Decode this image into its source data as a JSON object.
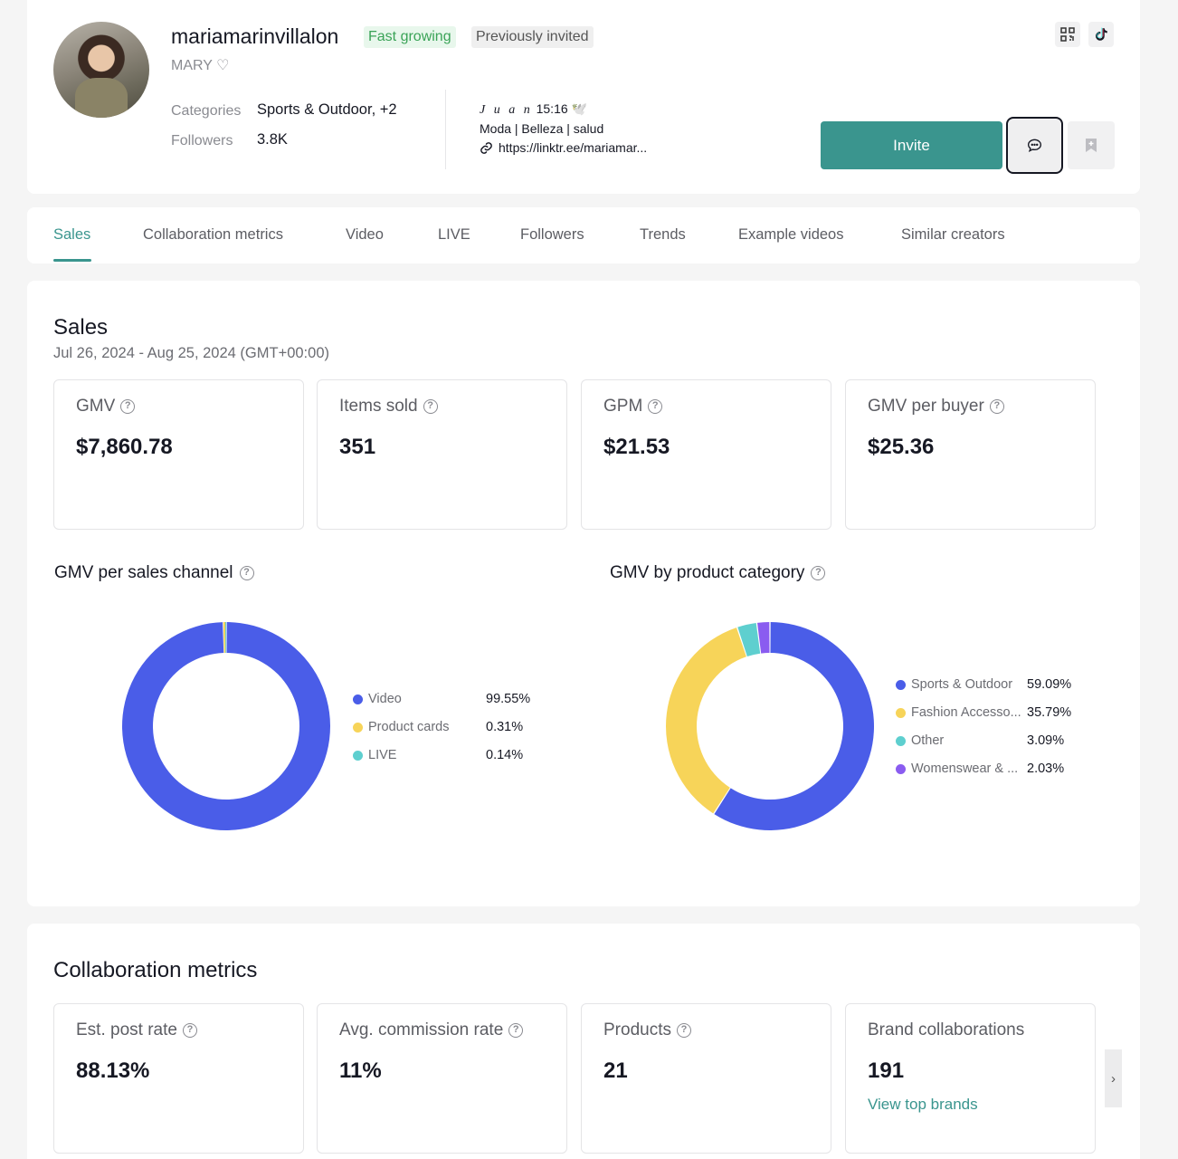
{
  "profile": {
    "username": "mariamarinvillalon",
    "badges": [
      "Fast growing",
      "Previously invited"
    ],
    "nickname": "MARY ♡",
    "categories_label": "Categories",
    "categories_value": "Sports & Outdoor, +2",
    "followers_label": "Followers",
    "followers_value": "3.8K",
    "bio_name": "J u a n",
    "bio_name_rest": "15:16 🕊️",
    "bio_line2": "Moda | Belleza  | salud",
    "bio_link": "https://linktr.ee/mariamar...",
    "invite_label": "Invite"
  },
  "tabs": [
    "Sales",
    "Collaboration metrics",
    "Video",
    "LIVE",
    "Followers",
    "Trends",
    "Example videos",
    "Similar creators"
  ],
  "sales": {
    "title": "Sales",
    "date_range": "Jul 26, 2024 - Aug 25, 2024 (GMT+00:00)",
    "metrics": [
      {
        "label": "GMV",
        "value": "$7,860.78"
      },
      {
        "label": "Items sold",
        "value": "351"
      },
      {
        "label": "GPM",
        "value": "$21.53"
      },
      {
        "label": "GMV per buyer",
        "value": "$25.36"
      }
    ],
    "channel_title": "GMV per sales channel",
    "category_title": "GMV by product category"
  },
  "chart_data": [
    {
      "type": "pie",
      "title": "GMV per sales channel",
      "categories": [
        "Video",
        "Product cards",
        "LIVE"
      ],
      "values": [
        99.55,
        0.31,
        0.14
      ],
      "labels": [
        "99.55%",
        "0.31%",
        "0.14%"
      ],
      "colors": [
        "#4a5de8",
        "#f7d459",
        "#5ecfcf"
      ]
    },
    {
      "type": "pie",
      "title": "GMV by product category",
      "categories": [
        "Sports & Outdoor",
        "Fashion Accesso...",
        "Other",
        "Womenswear & ..."
      ],
      "values": [
        59.09,
        35.79,
        3.09,
        2.03
      ],
      "labels": [
        "59.09%",
        "35.79%",
        "3.09%",
        "2.03%"
      ],
      "colors": [
        "#4a5de8",
        "#f7d459",
        "#5ecfcf",
        "#8a5cf0"
      ]
    }
  ],
  "collab": {
    "title": "Collaboration metrics",
    "metrics": [
      {
        "label": "Est. post rate",
        "value": "88.13%"
      },
      {
        "label": "Avg. commission rate",
        "value": "11%"
      },
      {
        "label": "Products",
        "value": "21"
      },
      {
        "label": "Brand collaborations",
        "value": "191",
        "link": "View top brands"
      }
    ]
  }
}
